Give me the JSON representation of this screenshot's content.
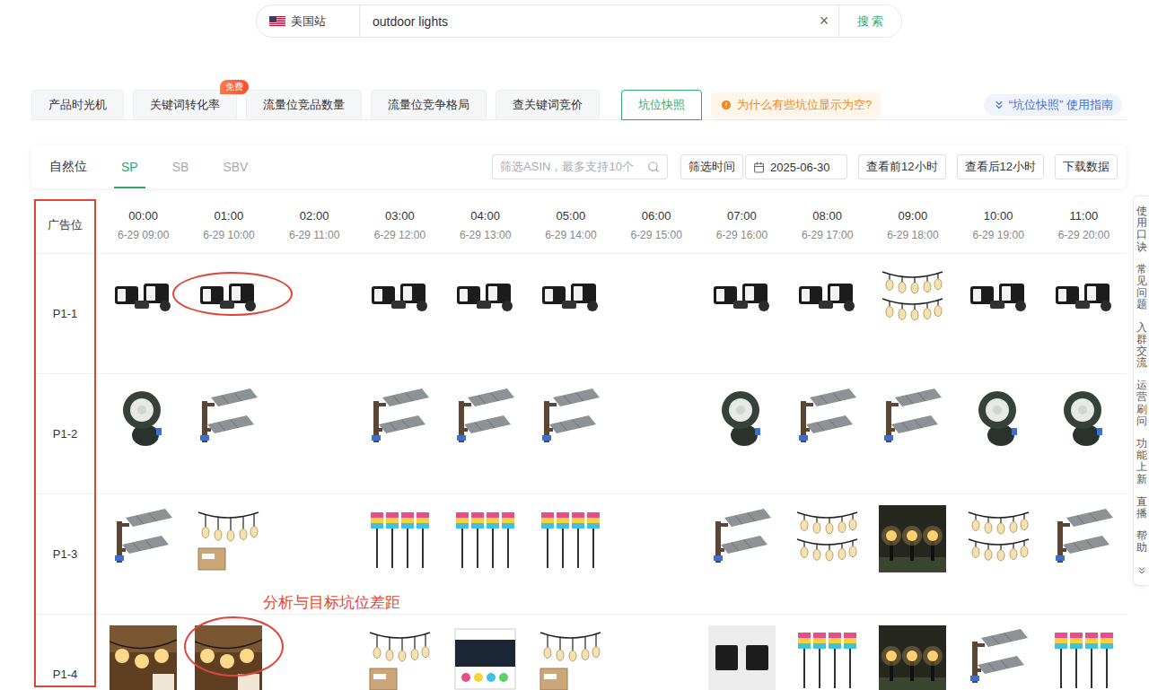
{
  "search": {
    "site": "美国站",
    "query": "outdoor lights",
    "clear": "×",
    "button": "搜 索"
  },
  "tabs": [
    {
      "label": "产品时光机",
      "selected": false
    },
    {
      "label": "关键词转化率",
      "selected": false,
      "badge": "免费"
    },
    {
      "label": "流量位竞品数量",
      "selected": false
    },
    {
      "label": "流量位竞争格局",
      "selected": false
    },
    {
      "label": "查关键词竞价",
      "selected": false
    },
    {
      "label": "坑位快照",
      "selected": true
    }
  ],
  "notice": {
    "text": "为什么有些坑位显示为空?"
  },
  "guide": {
    "text": "“坑位快照” 使用指南"
  },
  "placements": [
    {
      "label": "自然位",
      "selected": false,
      "disabled": false
    },
    {
      "label": "SP",
      "selected": true,
      "disabled": false
    },
    {
      "label": "SB",
      "selected": false,
      "disabled": true
    },
    {
      "label": "SBV",
      "selected": false,
      "disabled": true
    }
  ],
  "filter": {
    "asin_placeholder": "筛选ASIN，最多支持10个",
    "time_label": "筛选时间",
    "date": "2025-06-30",
    "buttons": [
      "查看前12小时",
      "查看后12小时",
      "下载数据"
    ]
  },
  "table": {
    "corner": "广告位",
    "columns": [
      {
        "time": "00:00",
        "local": "6-29 09:00"
      },
      {
        "time": "01:00",
        "local": "6-29 10:00"
      },
      {
        "time": "02:00",
        "local": "6-29 11:00"
      },
      {
        "time": "03:00",
        "local": "6-29 12:00"
      },
      {
        "time": "04:00",
        "local": "6-29 13:00"
      },
      {
        "time": "05:00",
        "local": "6-29 14:00"
      },
      {
        "time": "06:00",
        "local": "6-29 15:00"
      },
      {
        "time": "07:00",
        "local": "6-29 16:00"
      },
      {
        "time": "08:00",
        "local": "6-29 17:00"
      },
      {
        "time": "09:00",
        "local": "6-29 18:00"
      },
      {
        "time": "10:00",
        "local": "6-29 19:00"
      },
      {
        "time": "11:00",
        "local": "6-29 20:00"
      }
    ],
    "rows": [
      {
        "label": "P1-1",
        "cells": [
          {
            "kind": "floodlight",
            "circled": false
          },
          {
            "kind": "floodlight",
            "circled": true
          },
          {
            "kind": "empty",
            "circled": false
          },
          {
            "kind": "floodlight",
            "circled": false
          },
          {
            "kind": "floodlight",
            "circled": false
          },
          {
            "kind": "floodlight",
            "circled": false
          },
          {
            "kind": "empty",
            "circled": false
          },
          {
            "kind": "floodlight",
            "circled": false
          },
          {
            "kind": "floodlight",
            "circled": false
          },
          {
            "kind": "string-light",
            "circled": false
          },
          {
            "kind": "floodlight",
            "circled": false
          },
          {
            "kind": "floodlight",
            "circled": false
          }
        ]
      },
      {
        "label": "P1-2",
        "cells": [
          {
            "kind": "spotlight",
            "circled": false
          },
          {
            "kind": "area-light",
            "circled": false
          },
          {
            "kind": "empty",
            "circled": false
          },
          {
            "kind": "area-light",
            "circled": false
          },
          {
            "kind": "area-light",
            "circled": false
          },
          {
            "kind": "area-light",
            "circled": false
          },
          {
            "kind": "empty",
            "circled": false
          },
          {
            "kind": "spotlight",
            "circled": false
          },
          {
            "kind": "area-light",
            "circled": false
          },
          {
            "kind": "area-light",
            "circled": false
          },
          {
            "kind": "spotlight",
            "circled": false
          },
          {
            "kind": "spotlight",
            "circled": false
          }
        ]
      },
      {
        "label": "P1-3",
        "cells": [
          {
            "kind": "area-light",
            "circled": false
          },
          {
            "kind": "string-kit",
            "circled": false
          },
          {
            "kind": "empty",
            "circled": false
          },
          {
            "kind": "stake-light",
            "circled": false
          },
          {
            "kind": "stake-light",
            "circled": false
          },
          {
            "kind": "stake-light",
            "circled": false
          },
          {
            "kind": "empty",
            "circled": false
          },
          {
            "kind": "area-light",
            "circled": false
          },
          {
            "kind": "string-light",
            "circled": false
          },
          {
            "kind": "path-light",
            "circled": false
          },
          {
            "kind": "string-light",
            "circled": false
          },
          {
            "kind": "area-light",
            "circled": false
          }
        ]
      },
      {
        "label": "P1-4",
        "cells": [
          {
            "kind": "bulb-photo",
            "circled": false
          },
          {
            "kind": "bulb-photo",
            "circled": true
          },
          {
            "kind": "empty",
            "circled": false
          },
          {
            "kind": "string-kit",
            "circled": false
          },
          {
            "kind": "rgb-kit",
            "circled": false
          },
          {
            "kind": "string-kit",
            "circled": false
          },
          {
            "kind": "empty",
            "circled": false
          },
          {
            "kind": "wall-light",
            "circled": false
          },
          {
            "kind": "stake-light",
            "circled": false
          },
          {
            "kind": "path-light",
            "circled": false
          },
          {
            "kind": "area-light",
            "circled": false
          },
          {
            "kind": "stake-light",
            "circled": false
          }
        ]
      }
    ]
  },
  "annotation": {
    "text": "分析与目标坑位差距"
  },
  "side_rail": {
    "items": [
      "使用口诀",
      "常见问题",
      "入群交流",
      "运营刷问",
      "功能上新",
      "直播",
      "帮助"
    ]
  }
}
